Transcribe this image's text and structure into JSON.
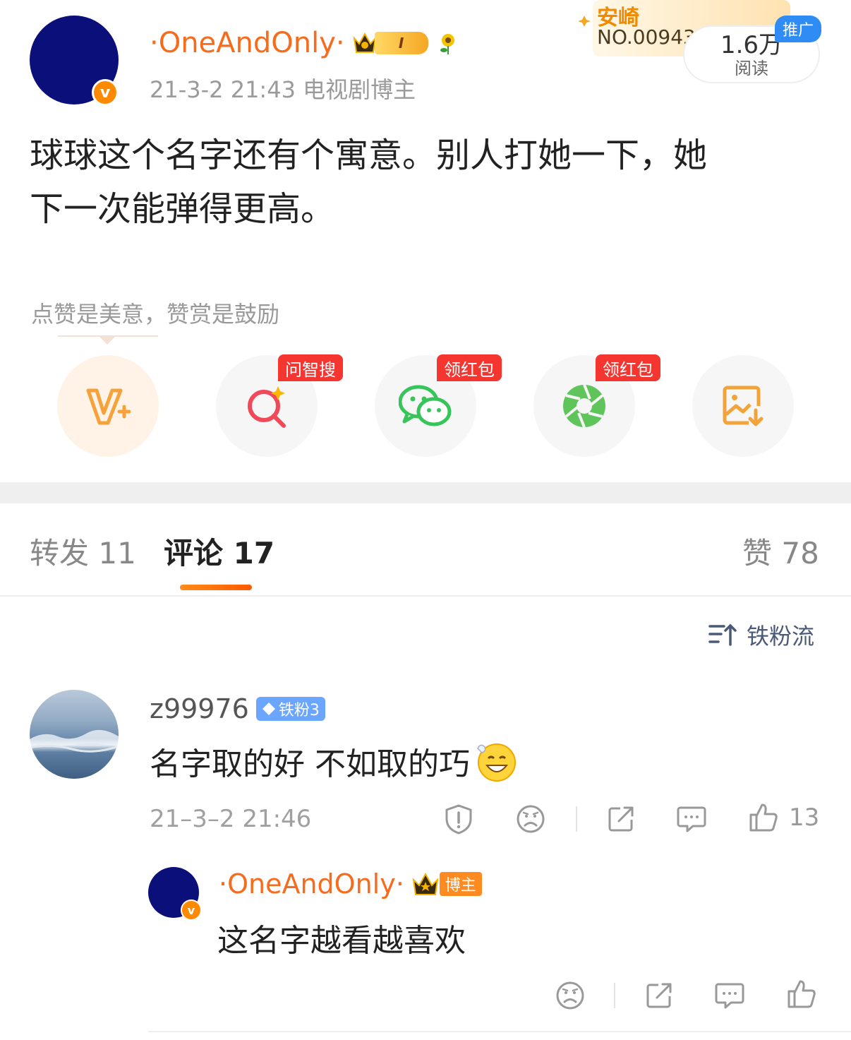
{
  "post": {
    "author": "·OneAndOnly·",
    "level": "I",
    "meta": "21-3-2 21:43  电视剧博主",
    "text_line1": "球球这个名字还有个寓意。别人打她一下，她",
    "text_line2": "下一次能弹得更高。",
    "promo_title": "安崎",
    "promo_no": "NO.00943",
    "read_count": "1.6万",
    "read_label": "阅读",
    "ad_tag": "推广",
    "reward_hint": "点赞是美意，赞赏是鼓励"
  },
  "share": {
    "items": [
      {
        "icon": "v-plus-icon",
        "tag": ""
      },
      {
        "icon": "search-ai-icon",
        "tag": "问智搜"
      },
      {
        "icon": "wechat-icon",
        "tag": "领红包"
      },
      {
        "icon": "moments-icon",
        "tag": "领红包"
      },
      {
        "icon": "save-image-icon",
        "tag": ""
      }
    ]
  },
  "tabs": {
    "repost": "转发 11",
    "comment": "评论 17",
    "like": "赞 78"
  },
  "sort": {
    "label": "铁粉流"
  },
  "comment": {
    "user": "z99976",
    "fan_badge": "铁粉3",
    "text": "名字取的好 不如取的巧",
    "time": "21–3–2 21:46",
    "like_count": "13"
  },
  "reply": {
    "author": "·OneAndOnly·",
    "host_tag": "博主",
    "text": "这名字越看越喜欢"
  },
  "colors": {
    "accent": "#f76b1c",
    "tab_indicator": "#ff6a00",
    "ad_blue": "#2f8cf5",
    "red_tag": "#f43530"
  }
}
